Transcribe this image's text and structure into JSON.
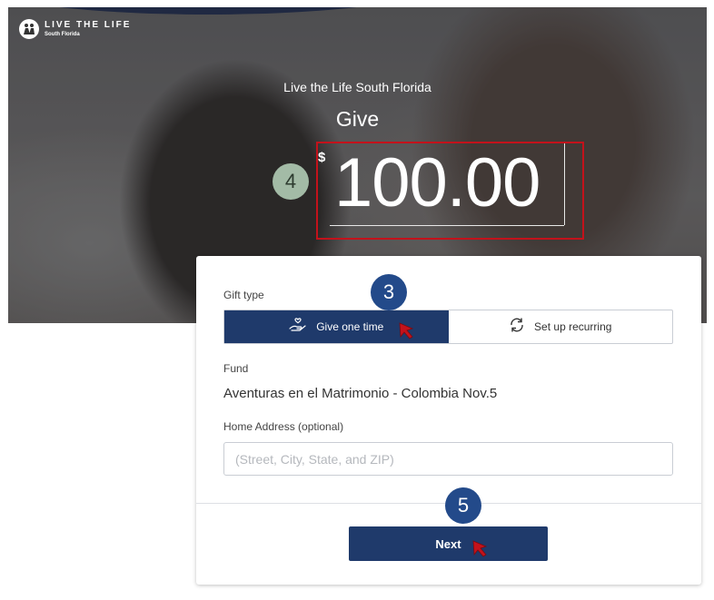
{
  "logo": {
    "title": "LIVE THE LIFE",
    "subtitle": "South Florida",
    "icon": "people-logo-icon"
  },
  "hero": {
    "org_name": "Live the Life South Florida",
    "title": "Give"
  },
  "amount": {
    "currency": "$",
    "value": "100.00"
  },
  "steps": {
    "amount_step": "4",
    "gift_type_step": "3",
    "next_step": "5"
  },
  "gift_type": {
    "label": "Gift type",
    "options": [
      {
        "label": "Give one time",
        "icon": "giving-hand-icon",
        "selected": true
      },
      {
        "label": "Set up recurring",
        "icon": "recurring-arrows-icon",
        "selected": false
      }
    ]
  },
  "fund": {
    "label": "Fund",
    "value": "Aventuras en el Matrimonio - Colombia Nov.5"
  },
  "address": {
    "label": "Home Address (optional)",
    "placeholder": "(Street, City, State, and ZIP)"
  },
  "next_button": {
    "label": "Next"
  },
  "colors": {
    "primary": "#1f3a6b",
    "step_badge": "#234a8a",
    "step_badge_alt": "#a3bba6",
    "highlight": "#c3121b",
    "cursor": "#c3121b"
  }
}
